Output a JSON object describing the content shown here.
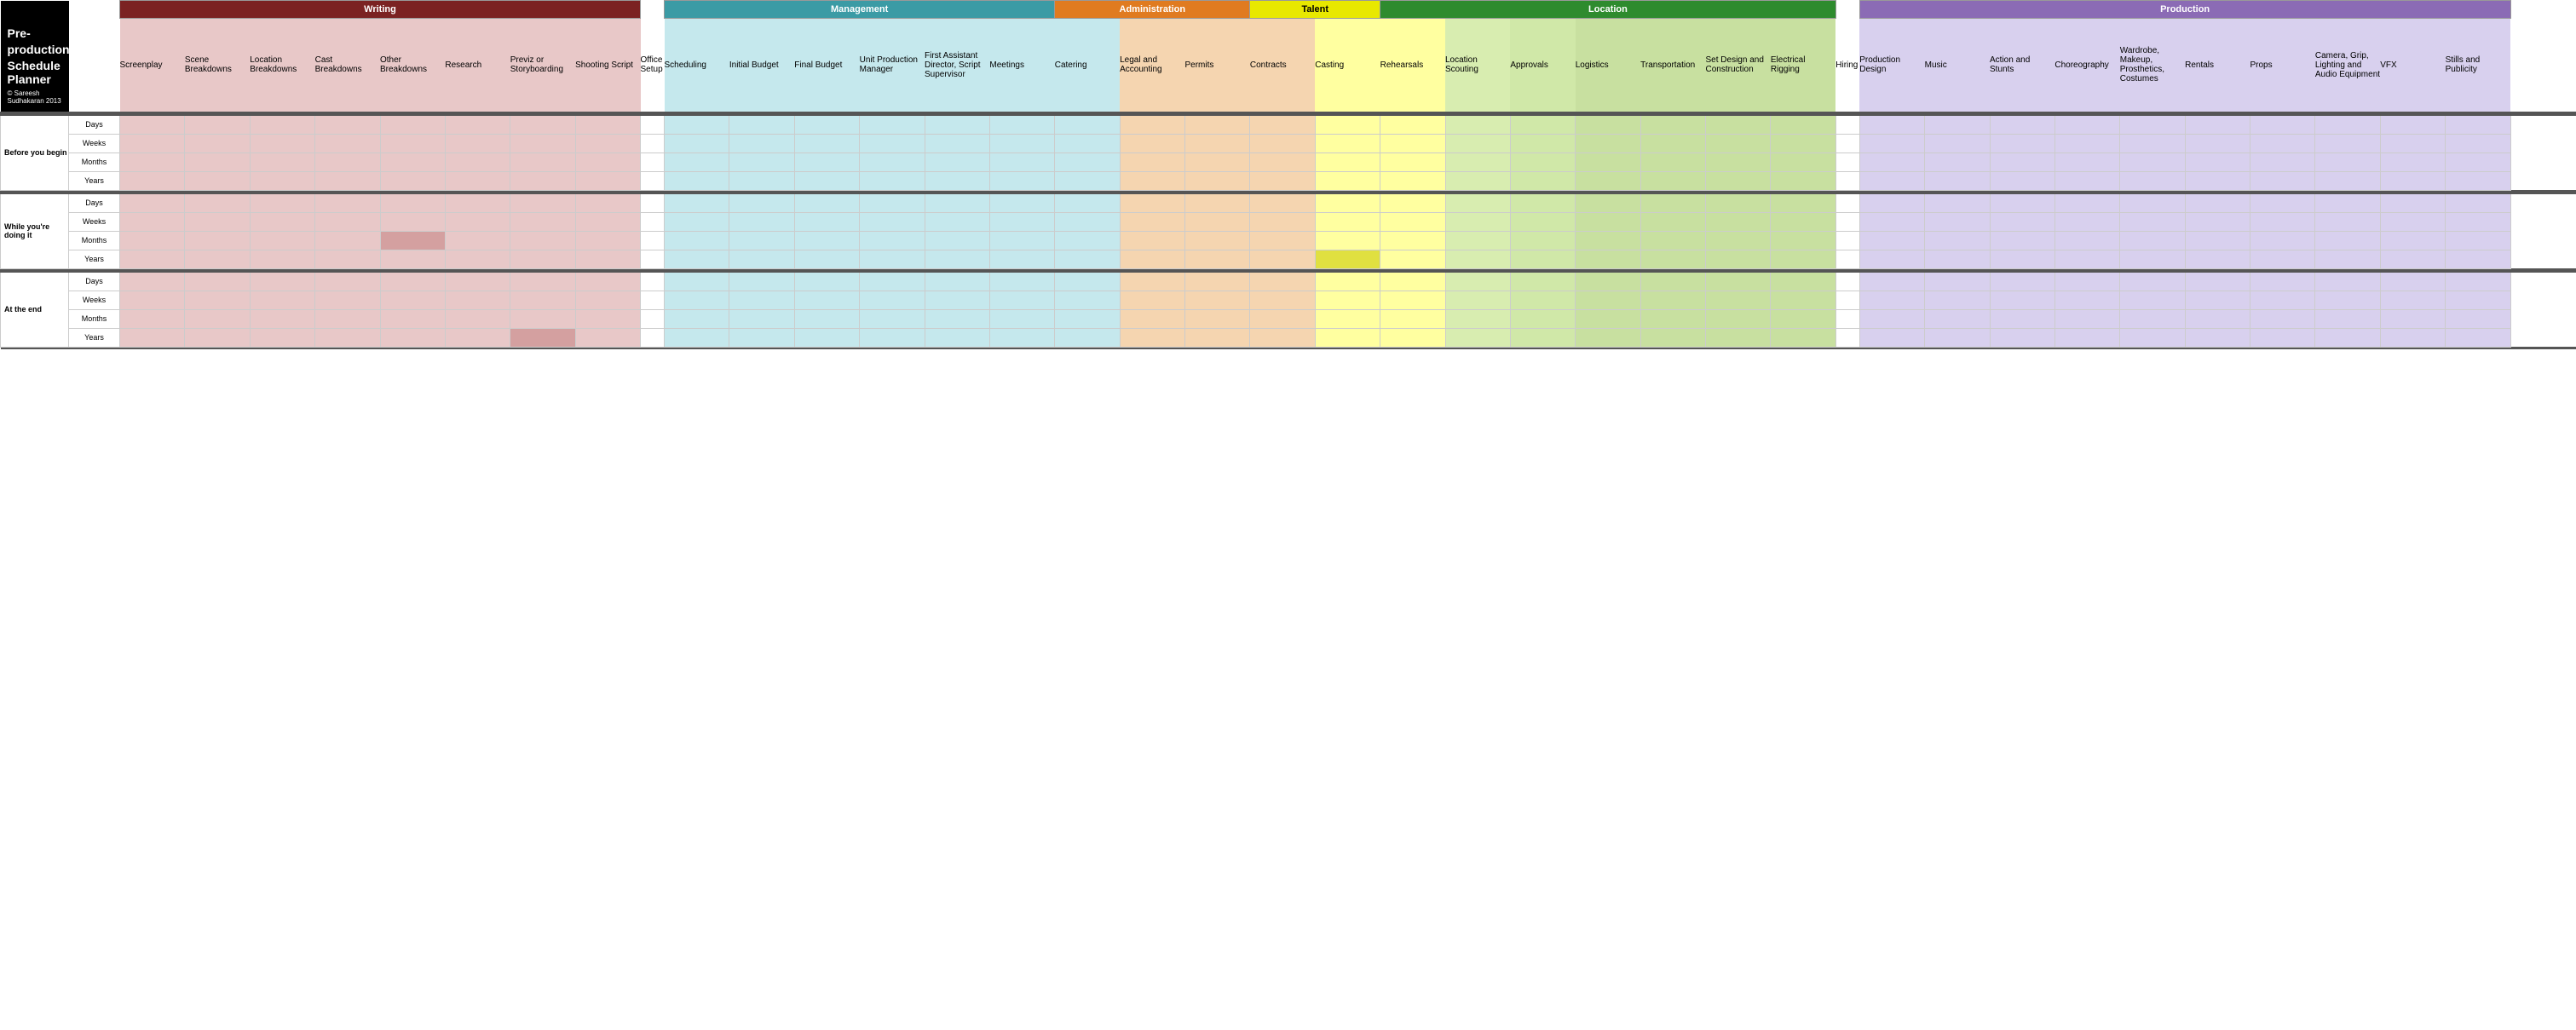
{
  "title": {
    "line1": "Pre-production",
    "line2": "Schedule",
    "line3": "Planner",
    "copyright": "Copyright",
    "author": "© Sareesh    Sudhakaran 2013"
  },
  "categories": [
    {
      "label": "Writing",
      "colspan": 9,
      "class": "cat-writing"
    },
    {
      "label": "Management",
      "colspan": 7,
      "class": "cat-management"
    },
    {
      "label": "Administration",
      "colspan": 3,
      "class": "cat-administration"
    },
    {
      "label": "Talent",
      "colspan": 2,
      "class": "cat-talent"
    },
    {
      "label": "Location",
      "colspan": 7,
      "class": "cat-location"
    },
    {
      "label": "Production",
      "colspan": 12,
      "class": "cat-production"
    }
  ],
  "columns": [
    {
      "label": "Screenplay",
      "color": "writing"
    },
    {
      "label": "Scene Breakdowns",
      "color": "writing"
    },
    {
      "label": "Location Breakdowns",
      "color": "writing"
    },
    {
      "label": "Cast Breakdowns",
      "color": "writing"
    },
    {
      "label": "Other Breakdowns",
      "color": "writing"
    },
    {
      "label": "Research",
      "color": "writing"
    },
    {
      "label": "Previz or Storyboarding",
      "color": "writing"
    },
    {
      "label": "Shooting Script",
      "color": "writing"
    },
    {
      "label": "Office Setup",
      "color": "white"
    },
    {
      "label": "Scheduling",
      "color": "management"
    },
    {
      "label": "Initial Budget",
      "color": "management"
    },
    {
      "label": "Final Budget",
      "color": "management"
    },
    {
      "label": "Unit Production Manager",
      "color": "management"
    },
    {
      "label": "First Assistant Director, Script Supervisor",
      "color": "management"
    },
    {
      "label": "Meetings",
      "color": "management"
    },
    {
      "label": "Catering",
      "color": "management"
    },
    {
      "label": "Legal and Accounting",
      "color": "administration"
    },
    {
      "label": "Permits",
      "color": "administration"
    },
    {
      "label": "Contracts",
      "color": "administration"
    },
    {
      "label": "Casting",
      "color": "talent"
    },
    {
      "label": "Rehearsals",
      "color": "talent"
    },
    {
      "label": "Location Scouting",
      "color": "location"
    },
    {
      "label": "Approvals",
      "color": "location"
    },
    {
      "label": "Logistics",
      "color": "location"
    },
    {
      "label": "Transportation",
      "color": "location"
    },
    {
      "label": "Set Design and Construction",
      "color": "location"
    },
    {
      "label": "Electrical Rigging",
      "color": "location"
    },
    {
      "label": "Hiring",
      "color": "white"
    },
    {
      "label": "Production Design",
      "color": "production"
    },
    {
      "label": "Music",
      "color": "production"
    },
    {
      "label": "Action and Stunts",
      "color": "production"
    },
    {
      "label": "Choreography",
      "color": "production"
    },
    {
      "label": "Wardrobe, Makeup, Prosthetics, Costumes",
      "color": "production"
    },
    {
      "label": "Rentals",
      "color": "production"
    },
    {
      "label": "Props",
      "color": "production"
    },
    {
      "label": "Camera, Grip, Lighting and Audio Equipment",
      "color": "production"
    },
    {
      "label": "VFX",
      "color": "production"
    },
    {
      "label": "Stills and Publicity",
      "color": "production"
    }
  ],
  "sections": [
    {
      "label": "Before you begin",
      "rows": [
        {
          "time": "Days"
        },
        {
          "time": "Weeks"
        },
        {
          "time": "Months"
        },
        {
          "time": "Years"
        }
      ]
    },
    {
      "label": "While you're doing it",
      "rows": [
        {
          "time": "Days"
        },
        {
          "time": "Weeks"
        },
        {
          "time": "Months"
        },
        {
          "time": "Years"
        }
      ]
    },
    {
      "label": "At the end",
      "rows": [
        {
          "time": "Days"
        },
        {
          "time": "Weeks"
        },
        {
          "time": "Months"
        },
        {
          "time": "Years"
        }
      ]
    }
  ]
}
